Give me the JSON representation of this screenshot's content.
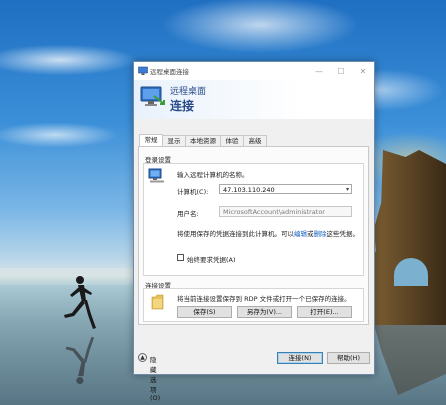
{
  "window": {
    "title": "远程桌面连接",
    "controls": {
      "minimize": "—",
      "maximize": "☐",
      "close": "✕"
    }
  },
  "banner": {
    "line1": "远程桌面",
    "line2": "连接"
  },
  "tabs": [
    {
      "label": "常规",
      "active": true
    },
    {
      "label": "显示",
      "active": false
    },
    {
      "label": "本地资源",
      "active": false
    },
    {
      "label": "体验",
      "active": false
    },
    {
      "label": "高级",
      "active": false
    }
  ],
  "login": {
    "group_title": "登录设置",
    "prompt": "输入远程计算机的名称。",
    "computer_label": "计算机(C):",
    "computer_value": "47.103.110.240",
    "username_label": "用户名:",
    "username_value": "MicrosoftAccount\\administrator",
    "info_prefix": "将使用保存的凭据连接到此计算机。可以",
    "info_edit_link": "编辑",
    "info_or": "或",
    "info_delete_link": "删除",
    "info_suffix": "这些凭据。",
    "always_ask_label": "始终要求凭据(A)",
    "always_ask_checked": false
  },
  "connection": {
    "group_title": "连接设置",
    "description": "将当前连接设置保存到 RDP 文件或打开一个已保存的连接。",
    "save_button": "保存(S)",
    "save_as_button": "另存为(V)...",
    "open_button": "打开(E)..."
  },
  "footer": {
    "hide_options": "隐藏选项(O)",
    "hide_options_icon": "▲",
    "connect_button": "连接(N)",
    "help_button": "帮助(H)"
  },
  "colors": {
    "banner_text": "#2a4a8a",
    "link": "#1060c0",
    "window_border": "#6d8aa8"
  },
  "icons": {
    "app": "remote-desktop-icon",
    "computer": "computer-icon",
    "folder": "folder-icon"
  }
}
